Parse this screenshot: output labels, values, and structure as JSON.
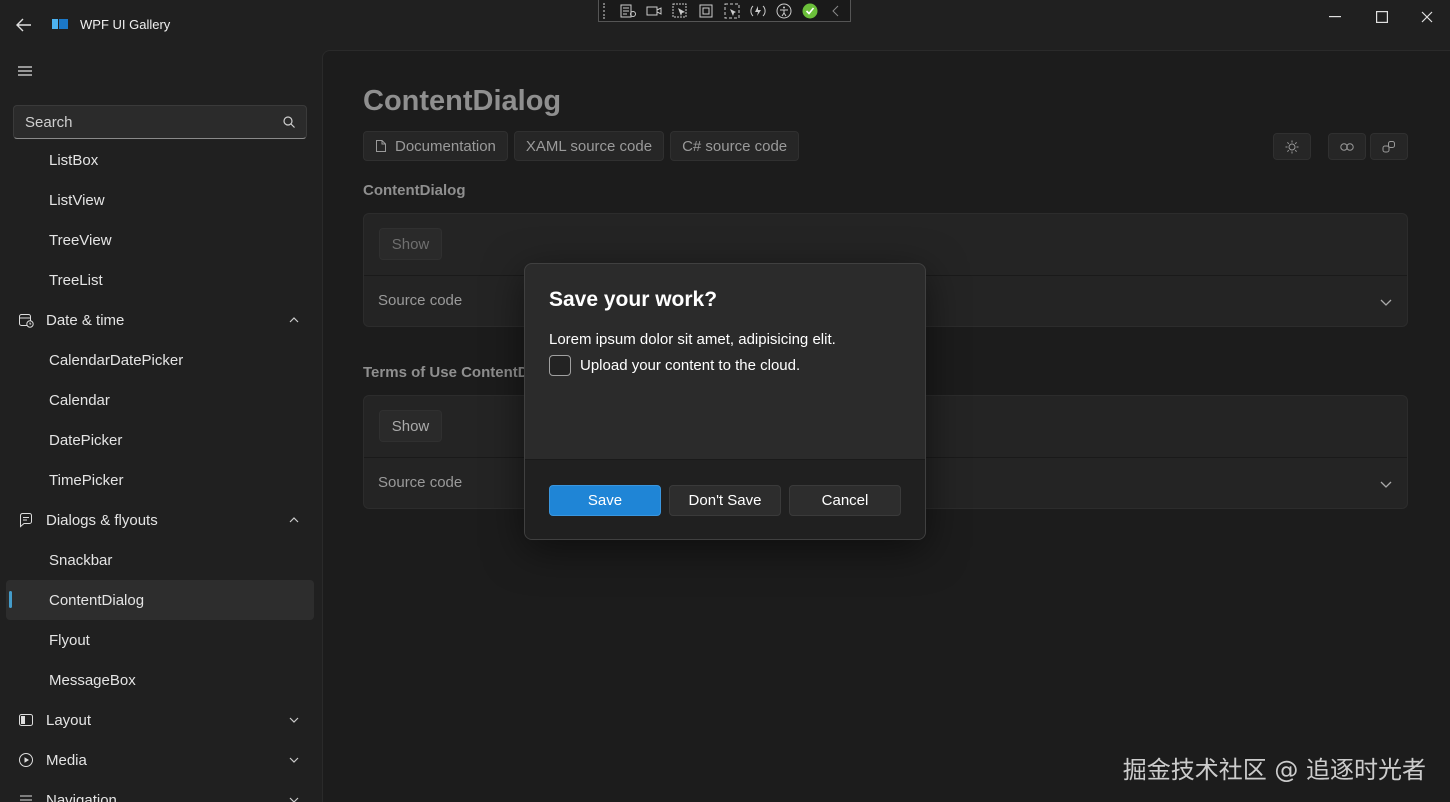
{
  "titlebar": {
    "title": "WPF UI Gallery"
  },
  "sidebar": {
    "search_placeholder": "Search",
    "items": [
      {
        "label": "ListBox"
      },
      {
        "label": "ListView"
      },
      {
        "label": "TreeView"
      },
      {
        "label": "TreeList"
      },
      {
        "label": "Date & time"
      },
      {
        "label": "CalendarDatePicker"
      },
      {
        "label": "Calendar"
      },
      {
        "label": "DatePicker"
      },
      {
        "label": "TimePicker"
      },
      {
        "label": "Dialogs & flyouts"
      },
      {
        "label": "Snackbar"
      },
      {
        "label": "ContentDialog"
      },
      {
        "label": "Flyout"
      },
      {
        "label": "MessageBox"
      },
      {
        "label": "Layout"
      },
      {
        "label": "Media"
      },
      {
        "label": "Navigation"
      }
    ]
  },
  "page": {
    "title": "ContentDialog",
    "buttons": {
      "documentation": "Documentation",
      "xaml": "XAML source code",
      "csharp": "C# source code"
    },
    "section1": {
      "title": "ContentDialog",
      "show": "Show",
      "source": "Source code"
    },
    "section2": {
      "title": "Terms of Use ContentD",
      "show": "Show",
      "source": "Source code"
    }
  },
  "dialog": {
    "title": "Save your work?",
    "body": "Lorem ipsum dolor sit amet, adipisicing elit.",
    "checkbox_label": "Upload your content to the cloud.",
    "checkbox_checked": false,
    "save": "Save",
    "dont_save": "Don't Save",
    "cancel": "Cancel"
  },
  "colors": {
    "accent": "#1f85d6",
    "selection_indicator": "#4cc2ff"
  },
  "watermark": "掘金技术社区 @ 追逐时光者"
}
